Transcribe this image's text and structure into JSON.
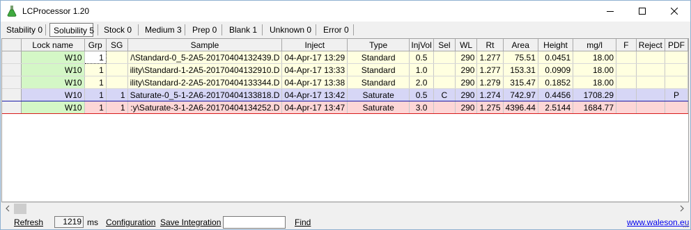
{
  "window": {
    "title": "LCProcessor 1.20",
    "icon": "flask-icon"
  },
  "tabs": [
    {
      "label": "Stability 0",
      "active": false
    },
    {
      "label": "Solubility 5",
      "active": true
    },
    {
      "label": "Stock 0",
      "active": false
    },
    {
      "label": "Medium 3",
      "active": false
    },
    {
      "label": "Prep 0",
      "active": false
    },
    {
      "label": "Blank 1",
      "active": false
    },
    {
      "label": "Unknown 0",
      "active": false
    },
    {
      "label": "Error 0",
      "active": false
    }
  ],
  "table": {
    "columns": [
      "Lock name",
      "Grp",
      "SG",
      "Sample",
      "Inject",
      "Type",
      "InjVol",
      "Sel",
      "WL",
      "Rt",
      "Area",
      "Height",
      "mg/l",
      "F",
      "Reject",
      "PDF"
    ],
    "rows": [
      {
        "lock": "W10",
        "grp": "1",
        "sg": "",
        "sample": "/\\Standard-0_5-2A5-20170404132439.D",
        "inject": "04-Apr-17 13:29",
        "type": "Standard",
        "injvol": "0.5",
        "sel": "",
        "wl": "290",
        "rt": "1.277",
        "area": "75.51",
        "height": "0.0451",
        "mgl": "18.00",
        "f": "",
        "reject": "",
        "pdf": ""
      },
      {
        "lock": "W10",
        "grp": "1",
        "sg": "",
        "sample": "ility\\Standard-1-2A5-20170404132910.D",
        "inject": "04-Apr-17 13:33",
        "type": "Standard",
        "injvol": "1.0",
        "sel": "",
        "wl": "290",
        "rt": "1.277",
        "area": "153.31",
        "height": "0.0909",
        "mgl": "18.00",
        "f": "",
        "reject": "",
        "pdf": ""
      },
      {
        "lock": "W10",
        "grp": "1",
        "sg": "",
        "sample": "ility\\Standard-2-2A5-20170404133344.D",
        "inject": "04-Apr-17 13:38",
        "type": "Standard",
        "injvol": "2.0",
        "sel": "",
        "wl": "290",
        "rt": "1.279",
        "area": "315.47",
        "height": "0.1852",
        "mgl": "18.00",
        "f": "",
        "reject": "",
        "pdf": ""
      },
      {
        "lock": "W10",
        "grp": "1",
        "sg": "1",
        "sample": "Saturate-0_5-1-2A6-20170404133818.D",
        "inject": "04-Apr-17 13:42",
        "type": "Saturate",
        "injvol": "0.5",
        "sel": "C",
        "wl": "290",
        "rt": "1.274",
        "area": "742.97",
        "height": "0.4456",
        "mgl": "1708.29",
        "f": "",
        "reject": "",
        "pdf": "P"
      },
      {
        "lock": "W10",
        "grp": "1",
        "sg": "1",
        "sample": ":y\\Saturate-3-1-2A6-20170404134252.D",
        "inject": "04-Apr-17 13:47",
        "type": "Saturate",
        "injvol": "3.0",
        "sel": "",
        "wl": "290",
        "rt": "1.275",
        "area": "4396.44",
        "height": "2.5144",
        "mgl": "1684.77",
        "f": "",
        "reject": "",
        "pdf": ""
      }
    ]
  },
  "statusbar": {
    "refresh": "Refresh",
    "ms_value": "1219",
    "ms_unit": "ms",
    "configuration": "Configuration",
    "save_integration": "Save Integration",
    "find_value": "",
    "find": "Find",
    "website": "www.waleson.eu"
  },
  "colors": {
    "standard_row": "#ffffe0",
    "selected_row": "#d6d6f6",
    "saturate_row": "#fdd6d6",
    "lock_cell": "#d4f7c6",
    "link": "#0000ee"
  }
}
